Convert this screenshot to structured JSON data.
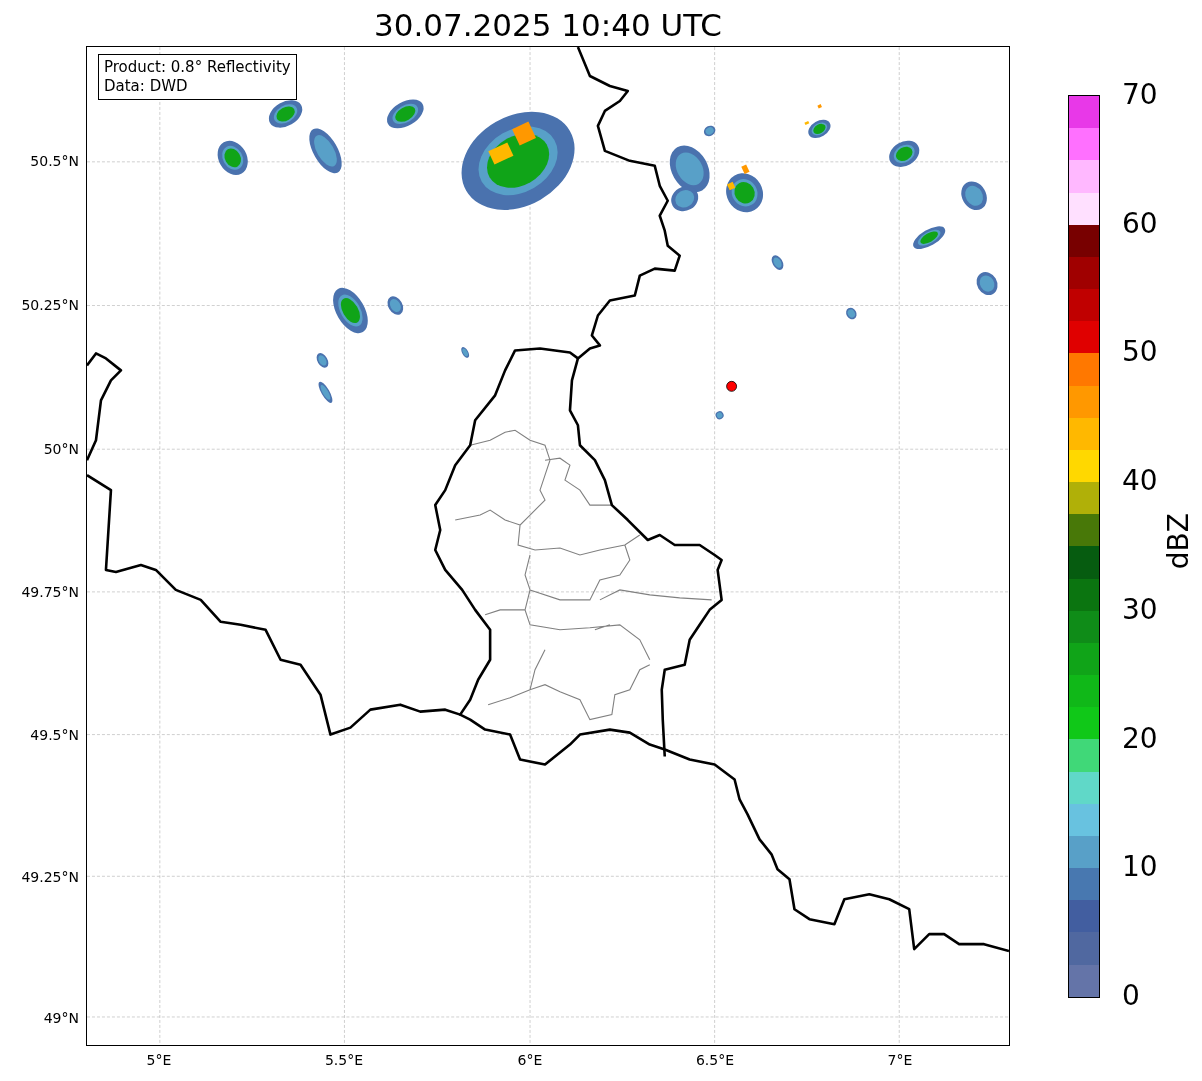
{
  "title": "30.07.2025 10:40 UTC",
  "info_box": [
    "Product: 0.8° Reflectivity",
    "Data: DWD"
  ],
  "y_ticks": [
    "50.5°N",
    "50.25°N",
    "50°N",
    "49.75°N",
    "49.5°N",
    "49.25°N",
    "49°N"
  ],
  "x_ticks": [
    "5°E",
    "5.5°E",
    "6°E",
    "6.5°E",
    "7°E"
  ],
  "colorbar": {
    "label": "dBZ",
    "ticks": [
      "70",
      "60",
      "50",
      "40",
      "30",
      "20",
      "10",
      "0"
    ],
    "segments": [
      {
        "color": "#e838e8"
      },
      {
        "color": "#ff70ff"
      },
      {
        "color": "#ffb8ff"
      },
      {
        "color": "#ffe0ff"
      },
      {
        "color": "#780000"
      },
      {
        "color": "#a00000"
      },
      {
        "color": "#c00000"
      },
      {
        "color": "#e00000"
      },
      {
        "color": "#ff7800"
      },
      {
        "color": "#ff9800"
      },
      {
        "color": "#ffb800"
      },
      {
        "color": "#ffd800"
      },
      {
        "color": "#b0b008"
      },
      {
        "color": "#487808"
      },
      {
        "color": "#065c10"
      },
      {
        "color": "#0b7510"
      },
      {
        "color": "#0f8c18"
      },
      {
        "color": "#10a418"
      },
      {
        "color": "#10b818"
      },
      {
        "color": "#10c818"
      },
      {
        "color": "#40d878"
      },
      {
        "color": "#60d8c8"
      },
      {
        "color": "#68c2e0"
      },
      {
        "color": "#58a0c8"
      },
      {
        "color": "#4878b0"
      },
      {
        "color": "#425ea0"
      },
      {
        "color": "#5068a0"
      },
      {
        "color": "#6474a8"
      }
    ]
  }
}
